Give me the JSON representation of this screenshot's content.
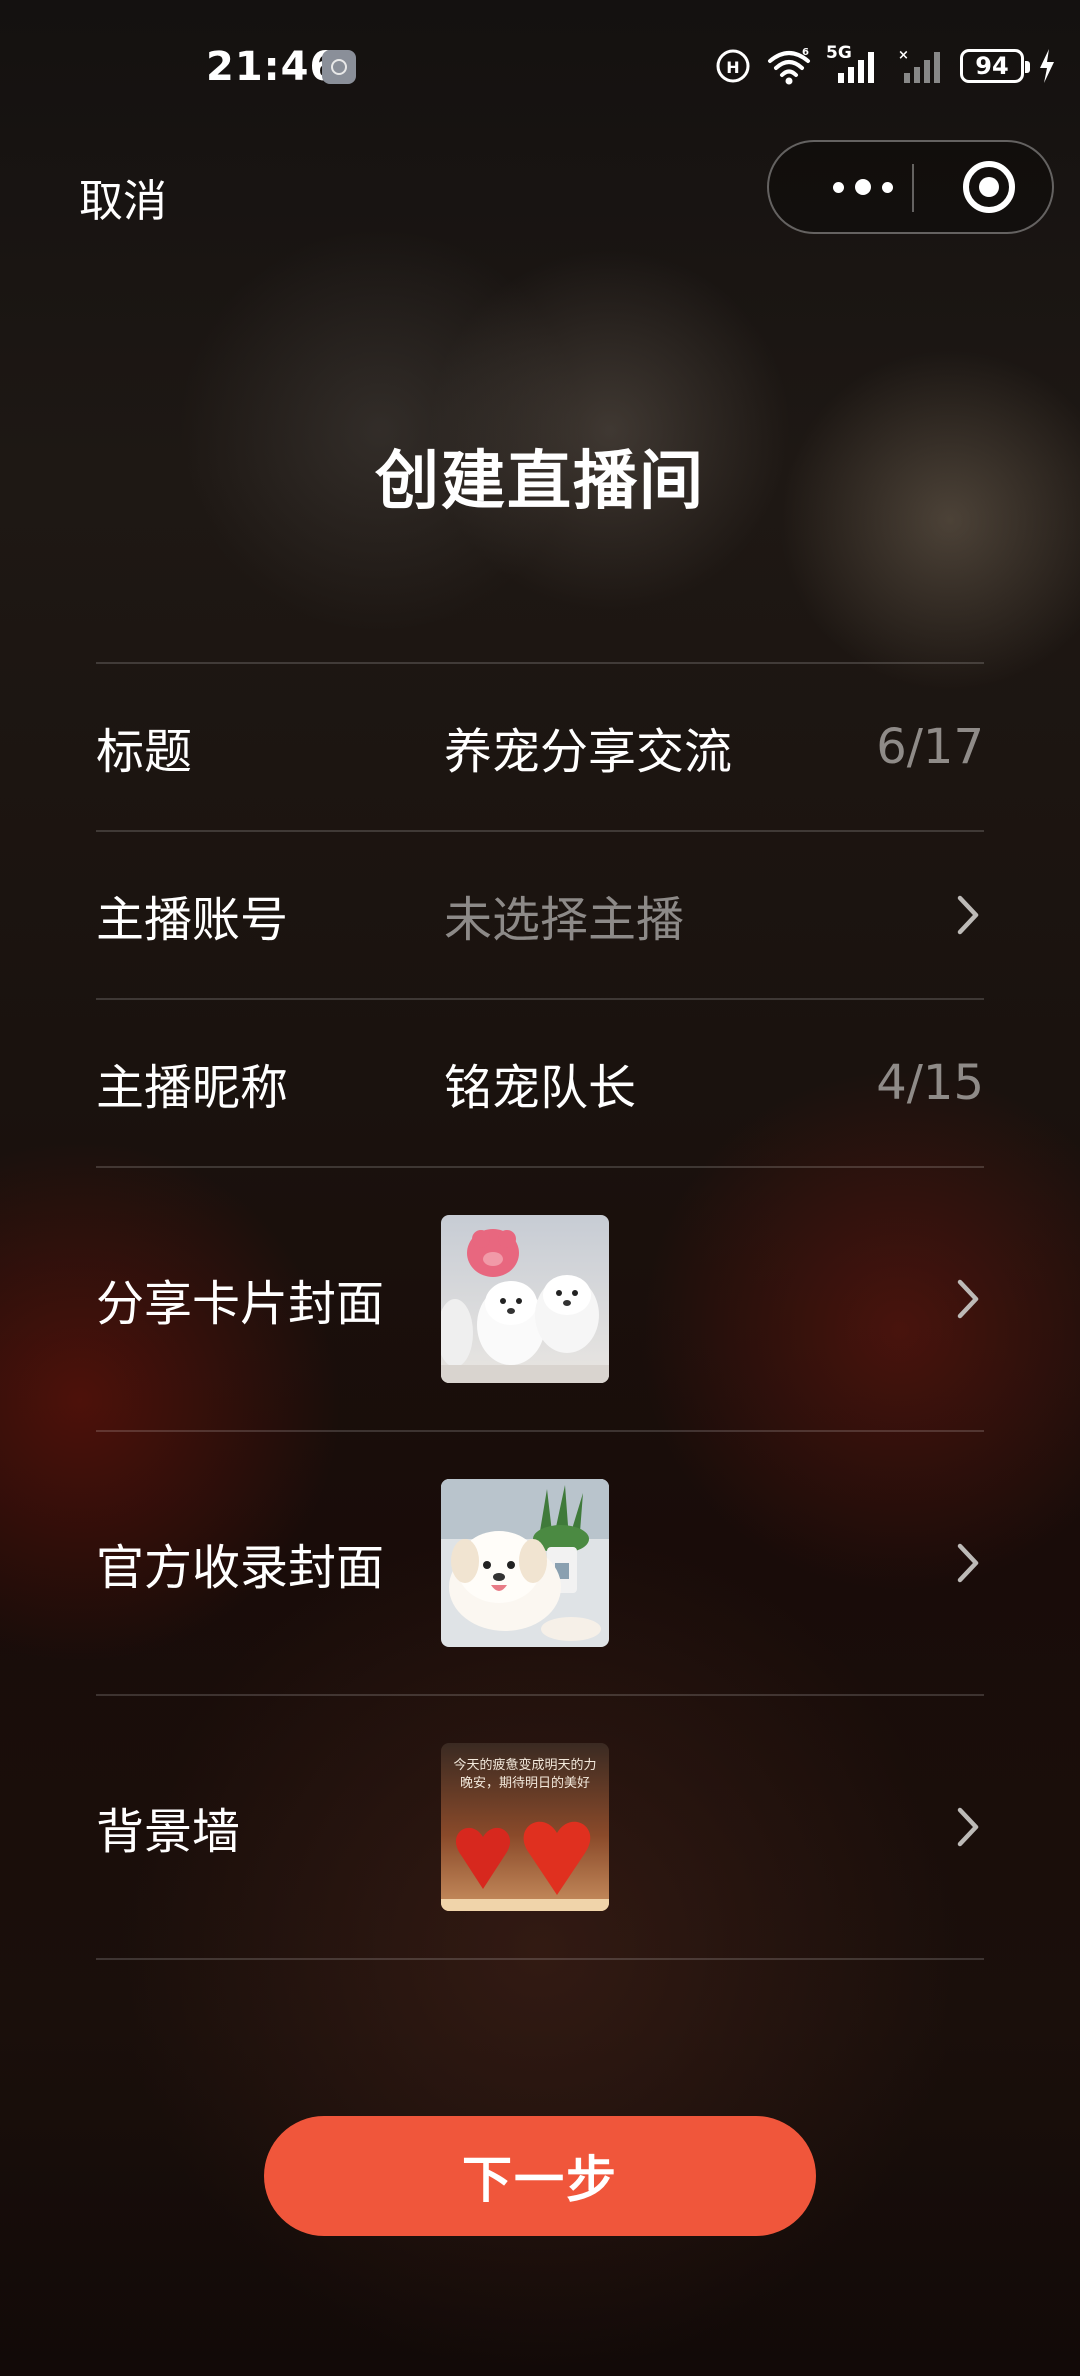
{
  "status_bar": {
    "time": "21:46",
    "network_label": "5G",
    "battery": "94"
  },
  "nav": {
    "cancel_label": "取消"
  },
  "page": {
    "title": "创建直播间"
  },
  "form": {
    "title_row": {
      "label": "标题",
      "value": "养宠分享交流",
      "count": "6/17"
    },
    "anchor_account_row": {
      "label": "主播账号",
      "placeholder": "未选择主播"
    },
    "anchor_nickname_row": {
      "label": "主播昵称",
      "value": "铭宠队长",
      "count": "4/15"
    },
    "share_cover_row": {
      "label": "分享卡片封面"
    },
    "official_cover_row": {
      "label": "官方收录封面"
    },
    "background_row": {
      "label": "背景墙",
      "thumb_text_line1": "今天的疲惫变成明天的力",
      "thumb_text_line2": "晚安，期待明日的美好"
    }
  },
  "footer": {
    "next_label": "下一步"
  },
  "colors": {
    "accent": "#f0563b",
    "muted_text": "#8d8a88"
  }
}
